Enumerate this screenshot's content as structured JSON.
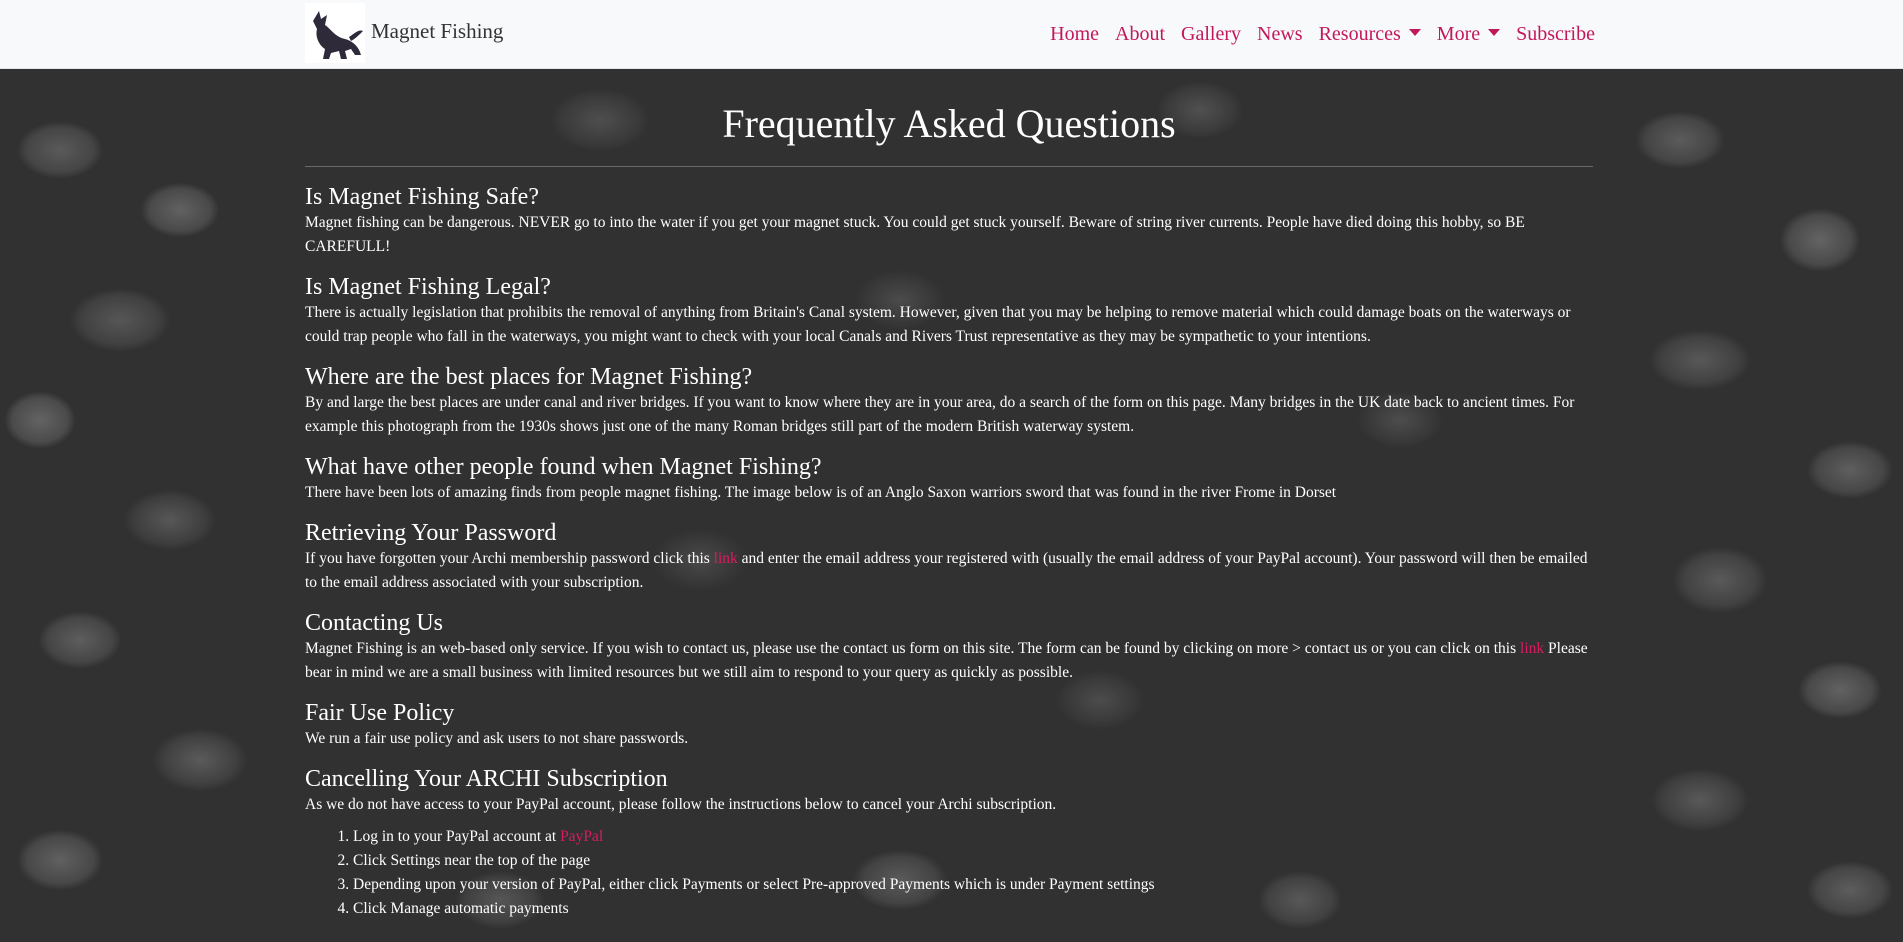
{
  "brand": {
    "name": "Magnet Fishing",
    "logo_icon": "dog-logo-icon"
  },
  "nav": {
    "items": [
      {
        "label": "Home",
        "dropdown": false
      },
      {
        "label": "About",
        "dropdown": false
      },
      {
        "label": "Gallery",
        "dropdown": false
      },
      {
        "label": "News",
        "dropdown": false
      },
      {
        "label": "Resources",
        "dropdown": true
      },
      {
        "label": "More",
        "dropdown": true
      },
      {
        "label": "Subscribe",
        "dropdown": false
      }
    ],
    "accent": "#c2185b"
  },
  "page": {
    "title": "Frequently Asked Questions"
  },
  "faqs": {
    "safe": {
      "q": "Is Magnet Fishing Safe?",
      "a": "Magnet fishing can be dangerous. NEVER go to into the water if you get your magnet stuck. You could get stuck yourself. Beware of string river currents. People have died doing this hobby, so BE CAREFULL!"
    },
    "legal": {
      "q": "Is Magnet Fishing Legal?",
      "a": "There is actually legislation that prohibits the removal of anything from Britain's Canal system. However, given that you may be helping to remove material which could damage boats on the waterways or could trap people who fall in the waterways, you might want to check with your local Canals and Rivers Trust representative as they may be sympathetic to your intentions."
    },
    "places": {
      "q": "Where are the best places for Magnet Fishing?",
      "a": "By and large the best places are under canal and river bridges. If you want to know where they are in your area, do a search of the form on this page. Many bridges in the UK date back to ancient times. For example this photograph from the 1930s shows just one of the many Roman bridges still part of the modern British waterway system."
    },
    "found": {
      "q": "What have other people found when Magnet Fishing?",
      "a": "There have been lots of amazing finds from people magnet fishing. The image below is of an Anglo Saxon warriors sword that was found in the river Frome in Dorset"
    },
    "password": {
      "q": "Retrieving Your Password",
      "a_before": "If you have forgotten your Archi membership password click this ",
      "link": "link",
      "a_after": " and enter the email address your registered with (usually the email address of your PayPal account). Your password will then be emailed to the email address associated with your subscription."
    },
    "contact": {
      "q": "Contacting Us",
      "a_before": "Magnet Fishing is an web-based only service. If you wish to contact us, please use the contact us form on this site. The form can be found by clicking on more > contact us or you can click on this ",
      "link": "link",
      "a_after": " Please bear in mind we are a small business with limited resources but we still aim to respond to your query as quickly as possible."
    },
    "fairuse": {
      "q": "Fair Use Policy",
      "a": "We run a fair use policy and ask users to not share passwords."
    },
    "cancel": {
      "q": "Cancelling Your ARCHI Subscription",
      "a": "As we do not have access to your PayPal account, please follow the instructions below to cancel your Archi subscription.",
      "steps": [
        {
          "before": "Log in to your PayPal account at ",
          "link": "PayPal",
          "after": ""
        },
        {
          "before": "Click Settings near the top of the page",
          "link": "",
          "after": ""
        },
        {
          "before": "Depending upon your version of PayPal, either click Payments or select Pre-approved Payments which is under Payment settings",
          "link": "",
          "after": ""
        },
        {
          "before": "Click Manage automatic payments",
          "link": "",
          "after": ""
        }
      ]
    }
  }
}
